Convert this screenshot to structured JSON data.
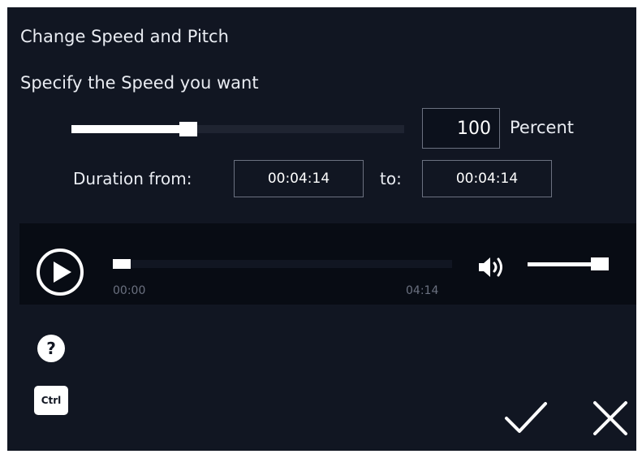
{
  "dialog": {
    "title": "Change Speed and Pitch",
    "subtitle": "Specify the Speed you want"
  },
  "speed": {
    "value": "100",
    "unit_label": "Percent",
    "slider_fraction": 0.35
  },
  "duration": {
    "from_label": "Duration from:",
    "from_value": "00:04:14",
    "to_label": "to:",
    "to_value": "00:04:14"
  },
  "player": {
    "current_time": "00:00",
    "total_time": "04:14",
    "seek_fraction": 0,
    "volume_fraction": 1.0
  },
  "icons": {
    "play": "play-icon",
    "volume": "volume-icon",
    "help": "help-icon",
    "ctrl": "ctrl-icon",
    "confirm": "check-icon",
    "close": "close-icon"
  },
  "buttons": {
    "help_label": "?",
    "ctrl_label": "Ctrl"
  },
  "colors": {
    "background": "#111622",
    "panel": "#080c14",
    "accent": "#ffffff"
  }
}
